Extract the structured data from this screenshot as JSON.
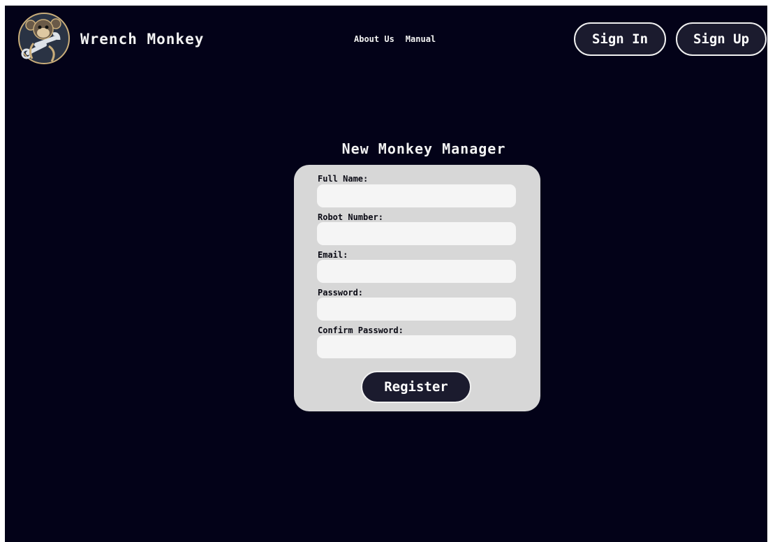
{
  "header": {
    "brand": "Wrench Monkey",
    "nav": [
      {
        "label": "About Us"
      },
      {
        "label": "Manual"
      }
    ],
    "sign_in_label": "Sign In",
    "sign_up_label": "Sign Up",
    "logo_icon": "monkey-wrench-logo"
  },
  "form": {
    "title": "New Monkey Manager",
    "fields": [
      {
        "label": "Full Name:",
        "value": ""
      },
      {
        "label": "Robot Number:",
        "value": ""
      },
      {
        "label": "Email:",
        "value": ""
      },
      {
        "label": "Password:",
        "value": ""
      },
      {
        "label": "Confirm Password:",
        "value": ""
      }
    ],
    "submit_label": "Register"
  },
  "colors": {
    "background": "#030218",
    "card": "#d7d7d7",
    "button": "#1b1b2e",
    "text_light": "#f3f3f3"
  }
}
